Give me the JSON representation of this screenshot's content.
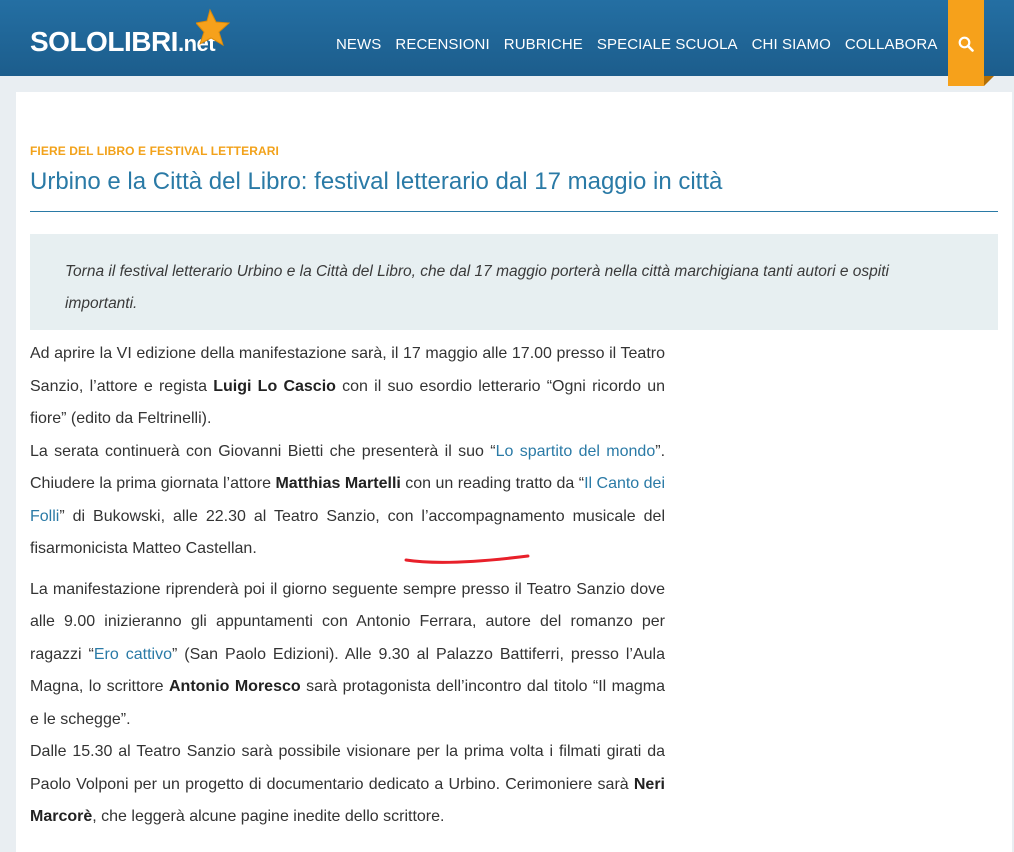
{
  "site": {
    "logo_main": "SOLOLIBRI",
    "logo_suffix": ".net"
  },
  "nav": {
    "items": [
      "NEWS",
      "RECENSIONI",
      "RUBRICHE",
      "SPECIALE SCUOLA",
      "CHI SIAMO",
      "COLLABORA"
    ]
  },
  "article": {
    "category": "FIERE DEL LIBRO E FESTIVAL LETTERARI",
    "title": "Urbino e la Città del Libro: festival letterario dal 17 maggio in città",
    "lead": "Torna il festival letterario Urbino e la Città del Libro, che dal 17 maggio porterà nella città marchigiana tanti autori e ospiti importanti.",
    "p1": {
      "t1": "Ad aprire la VI edizione della manifestazione sarà, il 17 maggio alle 17.00 presso il Teatro Sanzio, l’attore e regista ",
      "b1": "Luigi Lo Cascio",
      "t2": " con il suo esordio letterario “Ogni ricordo un fiore” (edito da Feltrinelli)."
    },
    "p2": {
      "t1": "La serata continuerà con Giovanni Bietti che presenterà il suo “",
      "l1": "Lo spartito del mondo",
      "t2": "”. Chiudere la prima giornata l’attore ",
      "b1": "Matthias Martelli",
      "t3": " con un reading tratto da “",
      "l2": "Il Canto dei Folli",
      "t4": "” di Bukowski, alle 22.30 al Teatro Sanzio, con l’accompagnamento musicale del fisarmonicista Matteo Castellan."
    },
    "p3": {
      "t1": "La manifestazione riprenderà poi il giorno seguente sempre presso il Teatro Sanzio dove alle 9.00 inizieranno gli appuntamenti con Antonio Ferrara, autore del romanzo per ragazzi “",
      "l1": "Ero cattivo",
      "t2": "” (San Paolo Edizioni). Alle 9.30 al Palazzo Battiferri, presso l’Aula Magna, lo scrittore ",
      "b1": "Antonio Moresco",
      "t3": " sarà protagonista dell’incontro dal titolo “Il magma e le schegge”."
    },
    "p4": {
      "t1": "Dalle 15.30 al Teatro Sanzio sarà possibile visionare per la prima volta i filmati girati da Paolo Volponi per un progetto di documentario dedicato a Urbino. Cerimoniere sarà ",
      "b1": "Neri Marcorè",
      "t2": ", che leggerà alcune pagine inedite dello scrittore."
    }
  },
  "colors": {
    "header": "#1f65956",
    "accent": "#f6a11b",
    "link": "#2a7aa6",
    "lead_bg": "#e7eff1",
    "annotation": "#e8202a"
  },
  "icons": [
    "star-logo-icon",
    "search-icon"
  ]
}
